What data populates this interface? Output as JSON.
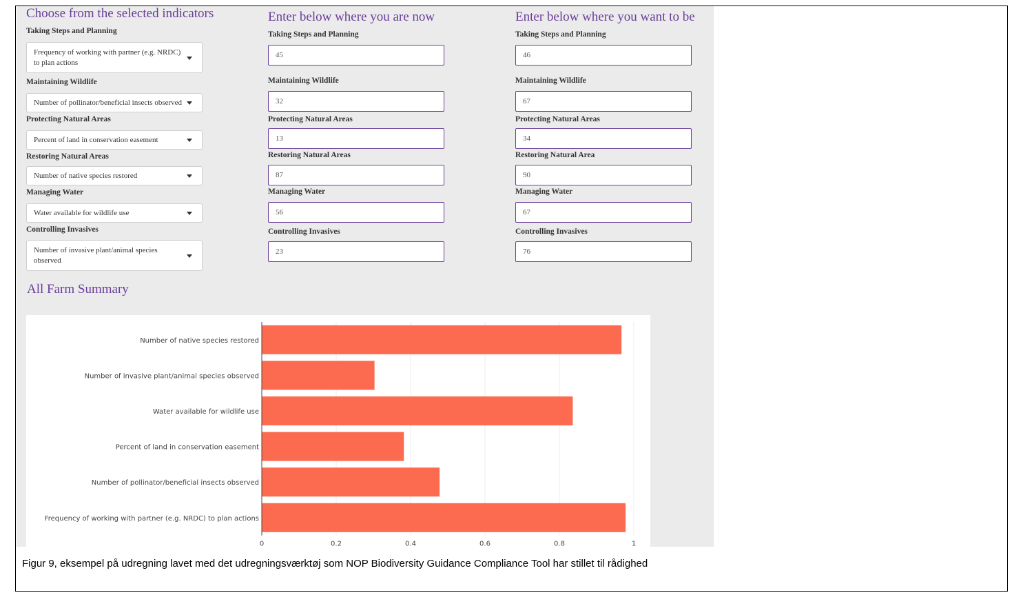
{
  "columns": {
    "choose": {
      "title": "Choose from the selected indicators"
    },
    "now": {
      "title": "Enter below where you are now"
    },
    "want": {
      "title": "Enter below where you want to be"
    }
  },
  "rows": [
    {
      "category": "Taking Steps and Planning",
      "now_label": "Taking Steps and Planning",
      "want_label": "Taking Steps and Planning",
      "indicator": "Frequency of working with partner (e.g. NRDC) to plan actions",
      "now": "45",
      "want": "46"
    },
    {
      "category": "Maintaining Wildlife",
      "now_label": "Maintaining Wildlife",
      "want_label": "Maintaining Wildlife",
      "indicator": "Number of pollinator/beneficial insects observed",
      "now": "32",
      "want": "67"
    },
    {
      "category": "Protecting Natural Areas",
      "now_label": "Protecting Natural Areas",
      "want_label": "Protecting Natural Areas",
      "indicator": "Percent of land in conservation easement",
      "now": "13",
      "want": "34"
    },
    {
      "category": "Restoring Natural Areas",
      "now_label": "Restoring Natural Areas",
      "want_label": "Restoring Natural Area",
      "indicator": "Number of native species restored",
      "now": "87",
      "want": "90"
    },
    {
      "category": "Managing Water",
      "now_label": "Managing Water",
      "want_label": "Managing Water",
      "indicator": "Water available for wildlife use",
      "now": "56",
      "want": "67"
    },
    {
      "category": "Controlling Invasives",
      "now_label": "Controlling Invasives",
      "want_label": "Controlling Invasives",
      "indicator": "Number of invasive plant/animal species observed",
      "now": "23",
      "want": "76"
    }
  ],
  "summary": {
    "title": "All Farm Summary"
  },
  "chart_data": {
    "type": "bar",
    "orientation": "horizontal",
    "categories": [
      "Number of native species restored",
      "Number of invasive plant/animal species observed",
      "Water available for wildlife use",
      "Percent of land in conservation easement",
      "Number of pollinator/beneficial insects observed",
      "Frequency of working with partner (e.g. NRDC) to plan actions"
    ],
    "values": [
      0.967,
      0.303,
      0.836,
      0.382,
      0.478,
      0.978
    ],
    "xlim": [
      0,
      1
    ],
    "xticks": [
      "0",
      "0.2",
      "0.4",
      "0.6",
      "0.8",
      "1"
    ],
    "grid": true,
    "bar_color": "#fc6a4f"
  },
  "caption": "Figur 9, eksempel på udregning lavet med det udregningsværktøj som NOP Biodiversity Guidance Compliance Tool har stillet til rådighed"
}
